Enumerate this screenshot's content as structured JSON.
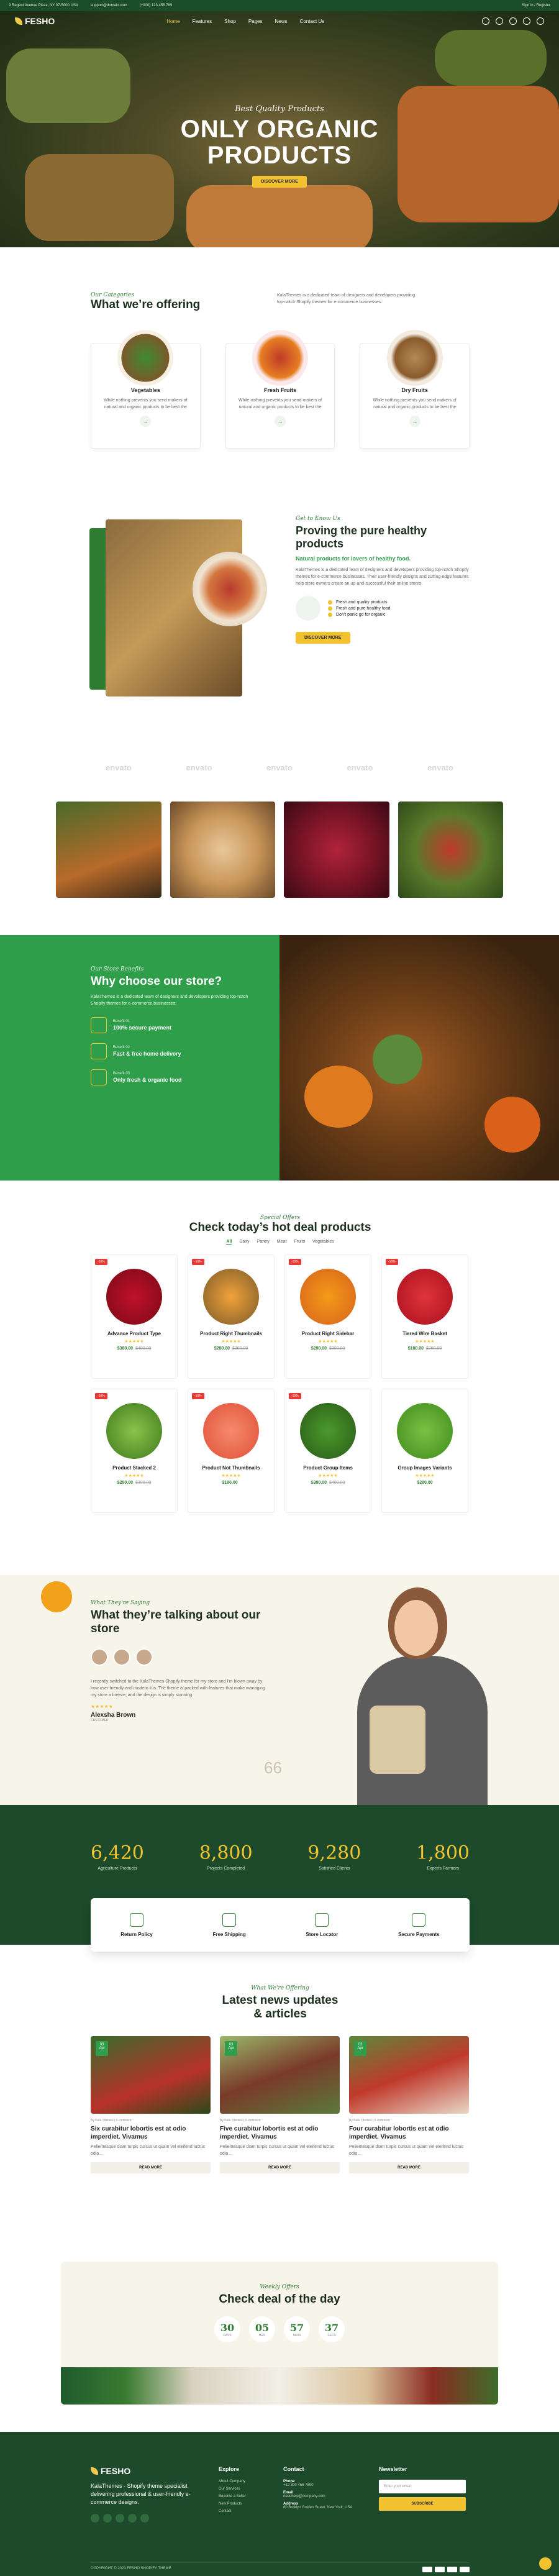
{
  "topbar": {
    "address": "9 Regent Avenue Plaza, NY 07-5000 USA",
    "email": "support@domain.com",
    "phone": "(+000) 123 456 789",
    "right": "Sign in / Register"
  },
  "header": {
    "logo": "FESHO",
    "nav": [
      "Home",
      "Features",
      "Shop",
      "Pages",
      "News",
      "Contact Us"
    ]
  },
  "hero": {
    "kicker": "Best Quality Products",
    "title": "ONLY ORGANIC\nPRODUCTS",
    "button": "DISCOVER MORE"
  },
  "offering": {
    "kicker": "Our Categories",
    "title": "What we’re offering",
    "desc": "KalaThemes is a dedicated team of designers and developers providing top-notch Shopify themes for e-commerce businesses.",
    "cards": [
      {
        "title": "Vegetables",
        "desc": "While nothing prevents you send makers of natural and organic products to be best the"
      },
      {
        "title": "Fresh Fruits",
        "desc": "While nothing prevents you send makers of natural and organic products to be best the"
      },
      {
        "title": "Dry Fruits",
        "desc": "While nothing prevents you send makers of natural and organic products to be best the"
      }
    ]
  },
  "healthy": {
    "kicker": "Get to Know Us",
    "title": "Proving the pure healthy products",
    "subtitle": "Natural products for lovers of healthy food.",
    "desc": "KalaThemes is a dedicated team of designers and developers providing top-notch Shopify themes for e-commerce businesses. Their user-friendly designs and cutting-edge features help store owners create an up-and-successful their online stores.",
    "checks": [
      "Fresh and quality products",
      "Fresh and pure healthy food",
      "Don't panic go for organic"
    ],
    "button": "DISCOVER MORE"
  },
  "partners": [
    "envato",
    "envato",
    "envato",
    "envato",
    "envato"
  ],
  "choose": {
    "kicker": "Our Store Benefits",
    "title": "Why choose our store?",
    "desc": "KalaThemes is a dedicated team of designers and developers providing top-notch Shopify themes for e-commerce businesses.",
    "features": [
      {
        "tag": "Benefit 01",
        "label": "100% secure payment"
      },
      {
        "tag": "Benefit 02",
        "label": "Fast & free home delivery"
      },
      {
        "tag": "Benefit 03",
        "label": "Only fresh & organic food"
      }
    ]
  },
  "products": {
    "kicker": "Special Offers",
    "title": "Check today’s hot deal products",
    "tabs": [
      "All",
      "Dairy",
      "Pantry",
      "Meat",
      "Fruits",
      "Vegetables"
    ],
    "items": [
      {
        "badge": "-10%",
        "name": "Advance Product Type",
        "stars": "★★★★★",
        "price": "$380.00",
        "old": "$400.00"
      },
      {
        "badge": "-10%",
        "name": "Product Right Thumbnails",
        "stars": "★★★★★",
        "price": "$280.00",
        "old": "$300.00"
      },
      {
        "badge": "-10%",
        "name": "Product Right Sidebar",
        "stars": "★★★★★",
        "price": "$280.00",
        "old": "$300.00"
      },
      {
        "badge": "-10%",
        "name": "Tiered Wire Basket",
        "stars": "★★★★★",
        "price": "$180.00",
        "old": "$200.00"
      },
      {
        "badge": "-10%",
        "name": "Product Stacked 2",
        "stars": "★★★★★",
        "price": "$280.00",
        "old": "$300.00"
      },
      {
        "badge": "-10%",
        "name": "Product Not Thumbnails",
        "stars": "★★★★★",
        "price": "$180.00",
        "old": ""
      },
      {
        "badge": "-10%",
        "name": "Product Group Items",
        "stars": "★★★★★",
        "price": "$380.00",
        "old": "$400.00"
      },
      {
        "badge": "",
        "name": "Group Images Variants",
        "stars": "★★★★★",
        "price": "$280.00",
        "old": ""
      }
    ]
  },
  "testimonial": {
    "kicker": "What They're Saying",
    "title": "What they’re talking about our store",
    "quote": "I recently switched to the KalaThemes Shopify theme for my store and I'm blown away by how user-friendly and modern it is. The theme is packed with features that make managing my store a breeze, and the design is simply stunning.",
    "stars": "★★★★★",
    "name": "Alexsha Brown",
    "role": "CUSTOMER"
  },
  "stats": [
    {
      "num": "6,420",
      "label": "Agriculture Products"
    },
    {
      "num": "8,800",
      "label": "Projects Completed"
    },
    {
      "num": "9,280",
      "label": "Satisfied Clients"
    },
    {
      "num": "1,800",
      "label": "Experts Farmers"
    }
  ],
  "services": [
    "Return Policy",
    "Free Shipping",
    "Store Locator",
    "Secure Payments"
  ],
  "blog": {
    "kicker": "What We're Offering",
    "title": "Latest news updates\n& articles",
    "posts": [
      {
        "day": "03",
        "mon": "Apr",
        "meta": "By Kala Themes  |  0 comment",
        "title": "Six curabitur lobortis est at odio imperdiet. Vivamus",
        "desc": "Pellentesque diam turpis cursus ut quam vel eleifend luctus odio...",
        "more": "READ MORE"
      },
      {
        "day": "03",
        "mon": "Apr",
        "meta": "By Kala Themes  |  0 comment",
        "title": "Five curabitur lobortis est at odio imperdiet. Vivamus",
        "desc": "Pellentesque diam turpis cursus ut quam vel eleifend luctus odio...",
        "more": "READ MORE"
      },
      {
        "day": "03",
        "mon": "Apr",
        "meta": "By Kala Themes  |  0 comment",
        "title": "Four curabitur lobortis est at odio imperdiet. Vivamus",
        "desc": "Pellentesque diam turpis cursus ut quam vel eleifend luctus odio...",
        "more": "READ MORE"
      }
    ]
  },
  "deal": {
    "kicker": "Weekly Offers",
    "title": "Check deal of the day",
    "timer": [
      {
        "n": "30",
        "u": "DAYS"
      },
      {
        "n": "05",
        "u": "HRS"
      },
      {
        "n": "57",
        "u": "MINS"
      },
      {
        "n": "37",
        "u": "SECS"
      }
    ]
  },
  "footer": {
    "logo": "FESHO",
    "desc": "KalaThemes - Shopify theme specialist delivering professional & user-friendly e-commerce designs.",
    "explore_title": "Explore",
    "explore": [
      "About Company",
      "Our Services",
      "Become a Seller",
      "New Products",
      "Contact"
    ],
    "contact_title": "Contact",
    "contact": [
      {
        "label": "Phone",
        "value": "+12 300 456 7890"
      },
      {
        "label": "Email",
        "value": "needhelp@company.com"
      },
      {
        "label": "Address",
        "value": "80 Broklyn Golden Street, New York, USA"
      }
    ],
    "newsletter_title": "Newsletter",
    "newsletter_placeholder": "Enter your email",
    "subscribe": "SUBSCRIBE",
    "copyright": "COPYRIGHT © 2023 FESHO SHOPIFY THEME"
  }
}
